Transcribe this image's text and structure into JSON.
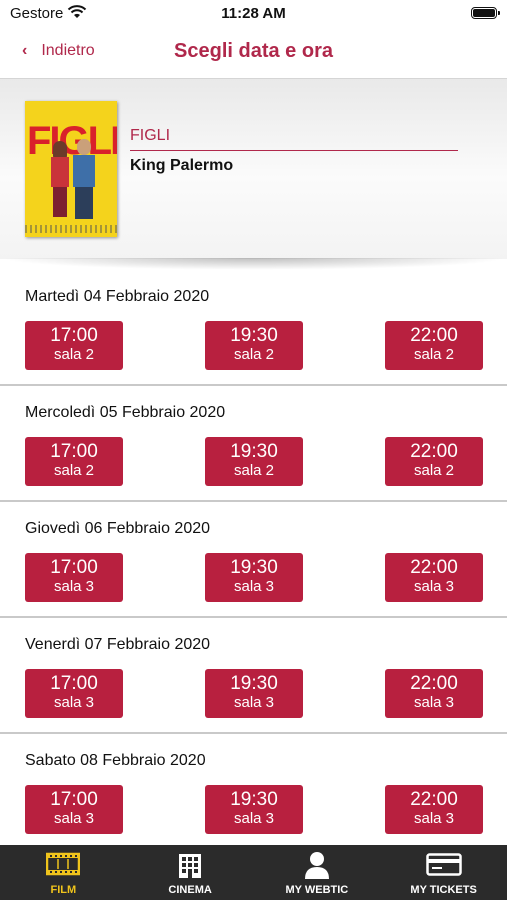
{
  "status_bar": {
    "carrier": "Gestore",
    "time": "11:28 AM"
  },
  "nav": {
    "back_label": "Indietro",
    "title": "Scegli data e ora"
  },
  "film": {
    "title": "FIGLI",
    "cinema": "King Palermo",
    "poster_title": "FIGLI"
  },
  "days": [
    {
      "label": "Martedì 04 Febbraio 2020",
      "shows": [
        {
          "time": "17:00",
          "room": "sala 2"
        },
        {
          "time": "19:30",
          "room": "sala 2"
        },
        {
          "time": "22:00",
          "room": "sala 2"
        }
      ]
    },
    {
      "label": "Mercoledì 05 Febbraio 2020",
      "shows": [
        {
          "time": "17:00",
          "room": "sala 2"
        },
        {
          "time": "19:30",
          "room": "sala 2"
        },
        {
          "time": "22:00",
          "room": "sala 2"
        }
      ]
    },
    {
      "label": "Giovedì 06 Febbraio 2020",
      "shows": [
        {
          "time": "17:00",
          "room": "sala 3"
        },
        {
          "time": "19:30",
          "room": "sala 3"
        },
        {
          "time": "22:00",
          "room": "sala 3"
        }
      ]
    },
    {
      "label": "Venerdì 07 Febbraio 2020",
      "shows": [
        {
          "time": "17:00",
          "room": "sala 3"
        },
        {
          "time": "19:30",
          "room": "sala 3"
        },
        {
          "time": "22:00",
          "room": "sala 3"
        }
      ]
    },
    {
      "label": "Sabato 08 Febbraio 2020",
      "shows": [
        {
          "time": "17:00",
          "room": "sala 3"
        },
        {
          "time": "19:30",
          "room": "sala 3"
        },
        {
          "time": "22:00",
          "room": "sala 3"
        }
      ]
    }
  ],
  "tabs": [
    {
      "label": "FILM",
      "icon": "film-strip-icon",
      "active": true
    },
    {
      "label": "CINEMA",
      "icon": "building-icon",
      "active": false
    },
    {
      "label": "MY WEBTIC",
      "icon": "user-icon",
      "active": false
    },
    {
      "label": "MY TICKETS",
      "icon": "card-icon",
      "active": false
    }
  ],
  "colors": {
    "accent": "#b8203f",
    "tab_active": "#f0c41c",
    "tab_bg": "#2b2b2b"
  }
}
